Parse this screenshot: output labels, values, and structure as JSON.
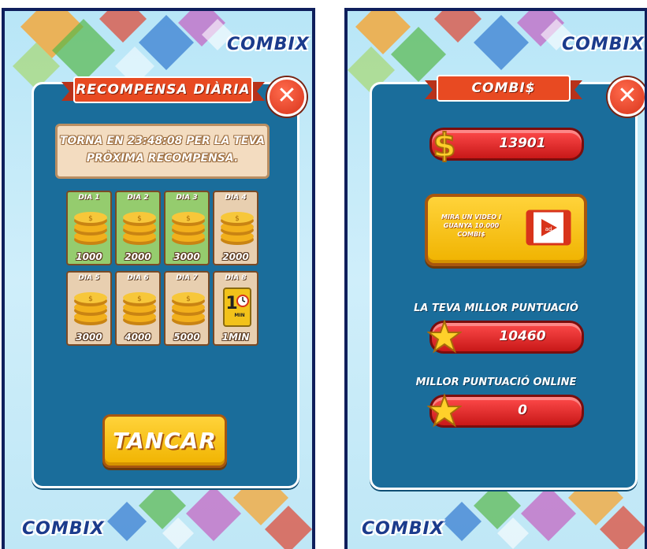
{
  "brand": {
    "logo_text": "COMBIX"
  },
  "colors": {
    "panel": "#1a6d9b",
    "ribbon": "#e84a22",
    "button_yellow": "#f5c000",
    "bar_red": "#d81f1f",
    "claimed_tile": "#95cc6e",
    "locked_tile": "#e8cfb0"
  },
  "daily_reward": {
    "title": "RECOMPENSA DIÀRIA",
    "close_icon": "close-x-icon",
    "message_line1": "TORNA EN 23:48:08 PER LA TEVA",
    "message_line2": "PRÒXIMA RECOMPENSA.",
    "days": [
      {
        "label": "DIA 1",
        "amount": "1000",
        "status": "claimed",
        "icon": "coin-stack-icon"
      },
      {
        "label": "DIA 2",
        "amount": "2000",
        "status": "claimed",
        "icon": "coin-stack-icon"
      },
      {
        "label": "DIA 3",
        "amount": "3000",
        "status": "claimed",
        "icon": "coin-stack-icon"
      },
      {
        "label": "DIA 4",
        "amount": "2000",
        "status": "locked",
        "icon": "coin-stack-icon"
      },
      {
        "label": "DIA 5",
        "amount": "3000",
        "status": "locked",
        "icon": "coin-stack-icon"
      },
      {
        "label": "DIA 6",
        "amount": "4000",
        "status": "locked",
        "icon": "coin-stack-icon"
      },
      {
        "label": "DIA 7",
        "amount": "5000",
        "status": "locked",
        "icon": "coin-stack-icon"
      },
      {
        "label": "DIA 8",
        "amount": "1MIN",
        "status": "locked",
        "icon": "one-minute-clock-icon",
        "icon_text": "1",
        "icon_subtext": "MIN"
      }
    ],
    "close_button_label": "TANCAR"
  },
  "combis": {
    "title": "COMBI$",
    "coins_value": "13901",
    "ad_button": {
      "line1": "MIRA UN VIDEO I",
      "line2": "GUANYA 10.000",
      "line3": "COMBI$",
      "icon": "video-ad-icon",
      "icon_text": "ad"
    },
    "best_score_label": "LA TEVA MILLOR PUNTUACIÓ",
    "best_score_value": "10460",
    "online_score_label": "MILLOR PUNTUACIÓ ONLINE",
    "online_score_value": "0"
  }
}
